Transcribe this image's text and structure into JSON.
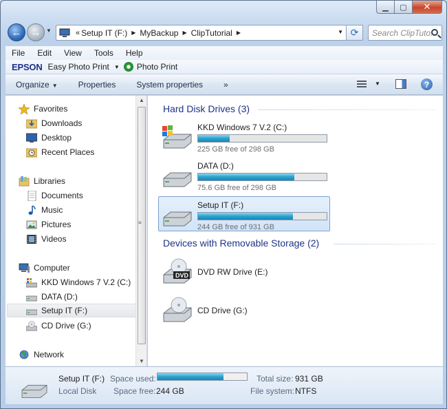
{
  "window": {
    "caption_buttons": {
      "minimize": "▁",
      "maximize": "▢",
      "close": "✕"
    }
  },
  "address_bar": {
    "overflow_chevron": "«",
    "crumbs": [
      "Setup IT (F:)",
      "MyBackup",
      "ClipTutorial"
    ],
    "search_placeholder": "Search ClipTuto..."
  },
  "menu": [
    "File",
    "Edit",
    "View",
    "Tools",
    "Help"
  ],
  "epson_bar": {
    "logo": "EPSON",
    "easy_photo_print": "Easy Photo Print",
    "photo_print": "Photo Print"
  },
  "command_bar": {
    "organize": "Organize",
    "properties": "Properties",
    "system_properties": "System properties",
    "more": "»",
    "help": "?"
  },
  "nav_pane": {
    "favorites": "Favorites",
    "favorites_items": [
      "Downloads",
      "Desktop",
      "Recent Places"
    ],
    "libraries": "Libraries",
    "libraries_items": [
      "Documents",
      "Music",
      "Pictures",
      "Videos"
    ],
    "computer": "Computer",
    "computer_items": [
      "KKD Windows 7 V.2  (C:)",
      "DATA (D:)",
      "Setup IT (F:)",
      "CD Drive (G:)"
    ],
    "network": "Network"
  },
  "content": {
    "hard_disk_header": "Hard Disk Drives (3)",
    "hard_drives": [
      {
        "name": "KKD Windows 7 V.2  (C:)",
        "free": "225 GB free of 298 GB",
        "used_fraction": 0.245,
        "selected": false
      },
      {
        "name": "DATA (D:)",
        "free": "75.6 GB free of 298 GB",
        "used_fraction": 0.746,
        "selected": false
      },
      {
        "name": "Setup IT (F:)",
        "free": "244 GB free of 931 GB",
        "used_fraction": 0.738,
        "selected": true
      }
    ],
    "removable_header": "Devices with Removable Storage (2)",
    "removable": [
      {
        "name": "DVD RW Drive (E:)",
        "badge": "DVD"
      },
      {
        "name": "CD Drive (G:)"
      }
    ]
  },
  "details": {
    "name": "Setup IT (F:)",
    "type": "Local Disk",
    "space_used_label": "Space used:",
    "space_used_fraction": 0.738,
    "space_free_label": "Space free:",
    "space_free": "244 GB",
    "total_size_label": "Total size:",
    "total_size": "931 GB",
    "file_system_label": "File system:",
    "file_system": "NTFS"
  }
}
